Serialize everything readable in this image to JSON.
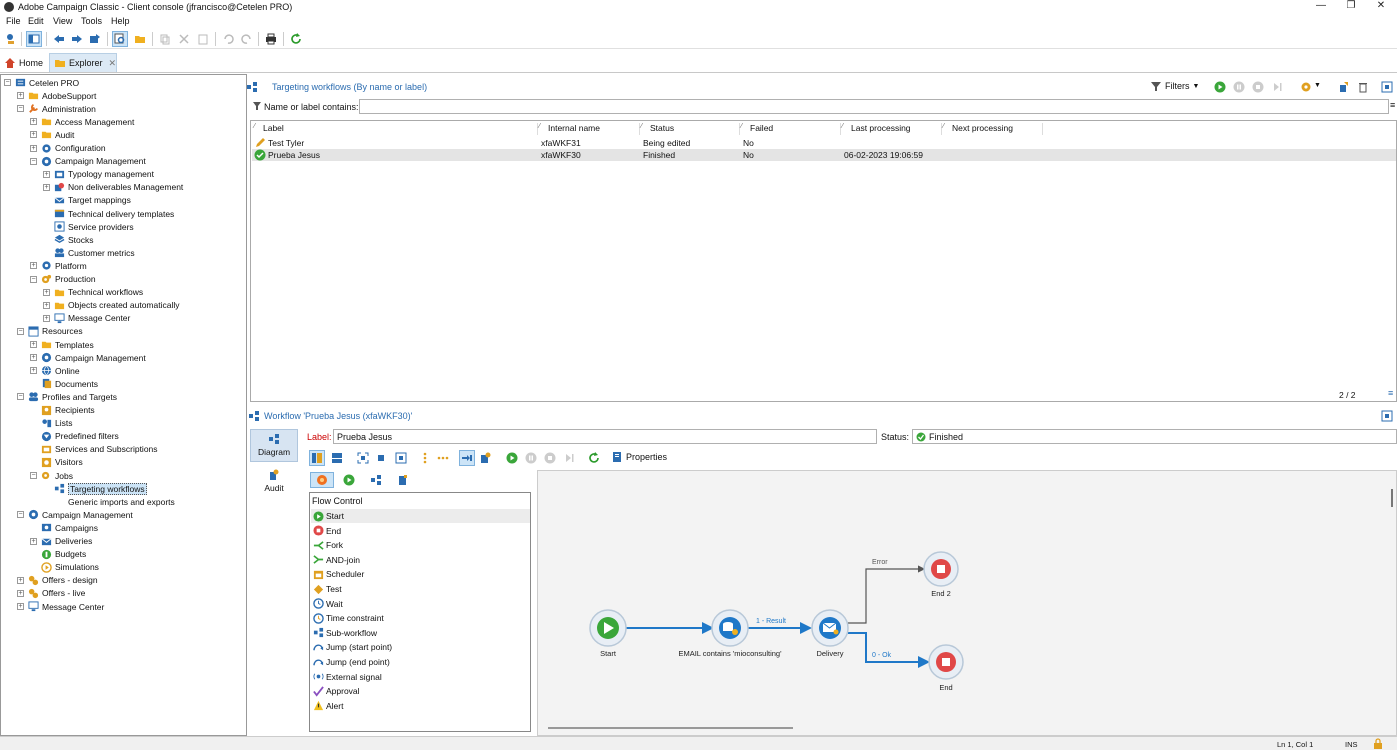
{
  "window": {
    "title": "Adobe Campaign Classic - Client console (jfrancisco@Cetelen PRO)"
  },
  "menu": [
    "File",
    "Edit",
    "View",
    "Tools",
    "Help"
  ],
  "tabs": {
    "home": "Home",
    "explorer": "Explorer"
  },
  "tree": [
    {
      "label": "Cetelen PRO",
      "depth": 0,
      "exp": "-",
      "icon": "server-icon"
    },
    {
      "label": "AdobeSupport",
      "depth": 1,
      "exp": "+",
      "icon": "folder-icon"
    },
    {
      "label": "Administration",
      "depth": 1,
      "exp": "-",
      "icon": "wrench-icon"
    },
    {
      "label": "Access Management",
      "depth": 2,
      "exp": "+",
      "icon": "folder-icon"
    },
    {
      "label": "Audit",
      "depth": 2,
      "exp": "+",
      "icon": "folder-icon"
    },
    {
      "label": "Configuration",
      "depth": 2,
      "exp": "+",
      "icon": "gear-icon"
    },
    {
      "label": "Campaign Management",
      "depth": 2,
      "exp": "-",
      "icon": "campaign-icon"
    },
    {
      "label": "Typology management",
      "depth": 3,
      "exp": "+",
      "icon": "typology-icon"
    },
    {
      "label": "Non deliverables Management",
      "depth": 3,
      "exp": "+",
      "icon": "blocked-icon"
    },
    {
      "label": "Target mappings",
      "depth": 3,
      "exp": "",
      "icon": "mapping-icon"
    },
    {
      "label": "Technical delivery templates",
      "depth": 3,
      "exp": "",
      "icon": "template-icon"
    },
    {
      "label": "Service providers",
      "depth": 3,
      "exp": "",
      "icon": "provider-icon"
    },
    {
      "label": "Stocks",
      "depth": 3,
      "exp": "",
      "icon": "stock-icon"
    },
    {
      "label": "Customer metrics",
      "depth": 3,
      "exp": "",
      "icon": "metrics-icon"
    },
    {
      "label": "Platform",
      "depth": 2,
      "exp": "+",
      "icon": "gear-icon"
    },
    {
      "label": "Production",
      "depth": 2,
      "exp": "-",
      "icon": "production-icon"
    },
    {
      "label": "Technical workflows",
      "depth": 3,
      "exp": "+",
      "icon": "folder-icon"
    },
    {
      "label": "Objects created automatically",
      "depth": 3,
      "exp": "+",
      "icon": "folder-icon"
    },
    {
      "label": "Message Center",
      "depth": 3,
      "exp": "+",
      "icon": "monitor-icon"
    },
    {
      "label": "Resources",
      "depth": 1,
      "exp": "-",
      "icon": "resources-icon"
    },
    {
      "label": "Templates",
      "depth": 2,
      "exp": "+",
      "icon": "folder-icon"
    },
    {
      "label": "Campaign Management",
      "depth": 2,
      "exp": "+",
      "icon": "campaign-icon"
    },
    {
      "label": "Online",
      "depth": 2,
      "exp": "+",
      "icon": "globe-icon"
    },
    {
      "label": "Documents",
      "depth": 2,
      "exp": "",
      "icon": "documents-icon"
    },
    {
      "label": "Profiles and Targets",
      "depth": 1,
      "exp": "-",
      "icon": "users-icon"
    },
    {
      "label": "Recipients",
      "depth": 2,
      "exp": "",
      "icon": "recipients-icon"
    },
    {
      "label": "Lists",
      "depth": 2,
      "exp": "",
      "icon": "lists-icon"
    },
    {
      "label": "Predefined filters",
      "depth": 2,
      "exp": "",
      "icon": "filter-icon"
    },
    {
      "label": "Services and Subscriptions",
      "depth": 2,
      "exp": "",
      "icon": "services-icon"
    },
    {
      "label": "Visitors",
      "depth": 2,
      "exp": "",
      "icon": "visitors-icon"
    },
    {
      "label": "Jobs",
      "depth": 2,
      "exp": "-",
      "icon": "jobs-icon"
    },
    {
      "label": "Targeting workflows",
      "depth": 3,
      "exp": "",
      "icon": "workflow-icon",
      "selected": true
    },
    {
      "label": "Generic imports and exports",
      "depth": 3,
      "exp": "",
      "icon": "blank"
    },
    {
      "label": "Campaign Management",
      "depth": 1,
      "exp": "-",
      "icon": "campaign-icon"
    },
    {
      "label": "Campaigns",
      "depth": 2,
      "exp": "",
      "icon": "campaigns-icon"
    },
    {
      "label": "Deliveries",
      "depth": 2,
      "exp": "+",
      "icon": "envelope-icon"
    },
    {
      "label": "Budgets",
      "depth": 2,
      "exp": "",
      "icon": "budget-icon"
    },
    {
      "label": "Simulations",
      "depth": 2,
      "exp": "",
      "icon": "simulation-icon"
    },
    {
      "label": "Offers - design",
      "depth": 1,
      "exp": "+",
      "icon": "offers-icon"
    },
    {
      "label": "Offers - live",
      "depth": 1,
      "exp": "+",
      "icon": "offers-icon"
    },
    {
      "label": "Message Center",
      "depth": 1,
      "exp": "+",
      "icon": "monitor-icon"
    }
  ],
  "list": {
    "title": "Targeting workflows (By name or label)",
    "filters": "Filters",
    "search_label": "Name or label contains:",
    "search_value": "",
    "columns": [
      "Label",
      "Internal name",
      "Status",
      "Failed",
      "Last processing",
      "Next processing"
    ],
    "rows": [
      {
        "label": "Test Tyler",
        "internal": "xfaWKF31",
        "status": "Being edited",
        "failed": "No",
        "last": "",
        "next": "",
        "icon": "pencil-icon"
      },
      {
        "label": "Prueba Jesus",
        "internal": "xfaWKF30",
        "status": "Finished",
        "failed": "No",
        "last": "06-02-2023 19:06:59",
        "next": "",
        "icon": "check-icon"
      }
    ],
    "pager": "2 / 2"
  },
  "workflow": {
    "title": "Workflow 'Prueba Jesus (xfaWKF30)'",
    "side_tabs": [
      "Diagram",
      "Audit"
    ],
    "label_caption": "Label:",
    "label_value": "Prueba Jesus",
    "status_caption": "Status:",
    "status_value": "Finished",
    "properties": "Properties",
    "palette_header": "Flow Control",
    "palette": [
      {
        "label": "Start",
        "icon": "start-icon",
        "selected": true
      },
      {
        "label": "End",
        "icon": "end-icon"
      },
      {
        "label": "Fork",
        "icon": "fork-icon"
      },
      {
        "label": "AND-join",
        "icon": "andjoin-icon"
      },
      {
        "label": "Scheduler",
        "icon": "scheduler-icon"
      },
      {
        "label": "Test",
        "icon": "test-icon"
      },
      {
        "label": "Wait",
        "icon": "wait-icon"
      },
      {
        "label": "Time constraint",
        "icon": "time-icon"
      },
      {
        "label": "Sub-workflow",
        "icon": "subworkflow-icon"
      },
      {
        "label": "Jump (start point)",
        "icon": "jump-icon"
      },
      {
        "label": "Jump (end point)",
        "icon": "jump-icon"
      },
      {
        "label": "External signal",
        "icon": "signal-icon"
      },
      {
        "label": "Approval",
        "icon": "approval-icon"
      },
      {
        "label": "Alert",
        "icon": "alert-icon"
      }
    ],
    "nodes": {
      "start": "Start",
      "query": "EMAIL contains 'mioconsulting'",
      "delivery": "Delivery",
      "end2": "End 2",
      "end": "End"
    },
    "edges": {
      "result": "1 - Result",
      "error": "Error",
      "ok": "0 - Ok"
    }
  },
  "status": {
    "pos": "Ln 1, Col 1",
    "mode": "INS"
  },
  "colors": {
    "accent": "#2b6cb0",
    "green": "#3aa63a",
    "red": "#e04848"
  }
}
